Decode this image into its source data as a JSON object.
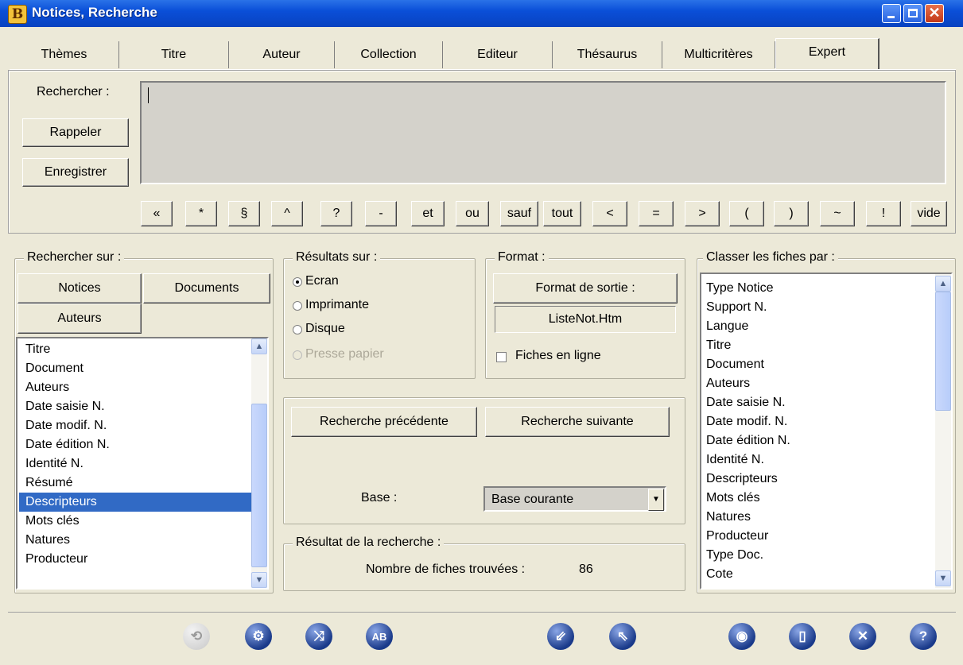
{
  "window": {
    "title": "Notices, Recherche",
    "app_glyph": "B"
  },
  "tabs": [
    "Thèmes",
    "Titre",
    "Auteur",
    "Collection",
    "Editeur",
    "Thésaurus",
    "Multicritères",
    "Expert"
  ],
  "active_tab": "Expert",
  "query": {
    "label": "Rechercher :",
    "value": "",
    "recall_button": "Rappeler",
    "save_button": "Enregistrer",
    "operators": [
      "«",
      "*",
      "§",
      "^",
      "?",
      "-",
      "et",
      "ou",
      "sauf",
      "tout",
      "<",
      "=",
      ">",
      "(",
      ")",
      "~",
      "!",
      "vide"
    ]
  },
  "search_on": {
    "label": "Rechercher sur :",
    "buttons": [
      "Notices",
      "Documents",
      "Auteurs"
    ],
    "fields": [
      "Titre",
      "Document",
      "Auteurs",
      "Date saisie N.",
      "Date modif. N.",
      "Date édition N.",
      "Identité N.",
      "Résumé",
      "Descripteurs",
      "Mots clés",
      "Natures",
      "Producteur"
    ],
    "selected": "Descripteurs"
  },
  "results_on": {
    "label": "Résultats sur :",
    "options": [
      "Ecran",
      "Imprimante",
      "Disque",
      "Presse papier"
    ],
    "selected": "Ecran",
    "disabled": [
      "Presse papier"
    ]
  },
  "format": {
    "label": "Format :",
    "output_button": "Format de sortie :",
    "output_value": "ListeNot.Htm",
    "inline_checkbox": "Fiches en ligne",
    "inline_checked": false
  },
  "navigation": {
    "previous_button": "Recherche précédente",
    "next_button": "Recherche suivante",
    "base_label": "Base :",
    "base_value": "Base courante"
  },
  "result": {
    "label": "Résultat de la recherche :",
    "count_label": "Nombre de fiches trouvées :",
    "count": "86"
  },
  "sort_by": {
    "label": "Classer les fiches par :",
    "fields": [
      "Type Notice",
      "Support N.",
      "Langue",
      "Titre",
      "Document",
      "Auteurs",
      "Date saisie N.",
      "Date modif. N.",
      "Date édition N.",
      "Identité N.",
      "Descripteurs",
      "Mots clés",
      "Natures",
      "Producteur",
      "Type Doc.",
      "Cote"
    ]
  },
  "toolbar": {
    "icons": [
      "refresh-icon",
      "settings-icon",
      "shuffle-icon",
      "spellcheck-icon",
      "import-icon",
      "export-icon",
      "view-icon",
      "page-icon",
      "close-icon",
      "help-icon"
    ]
  }
}
